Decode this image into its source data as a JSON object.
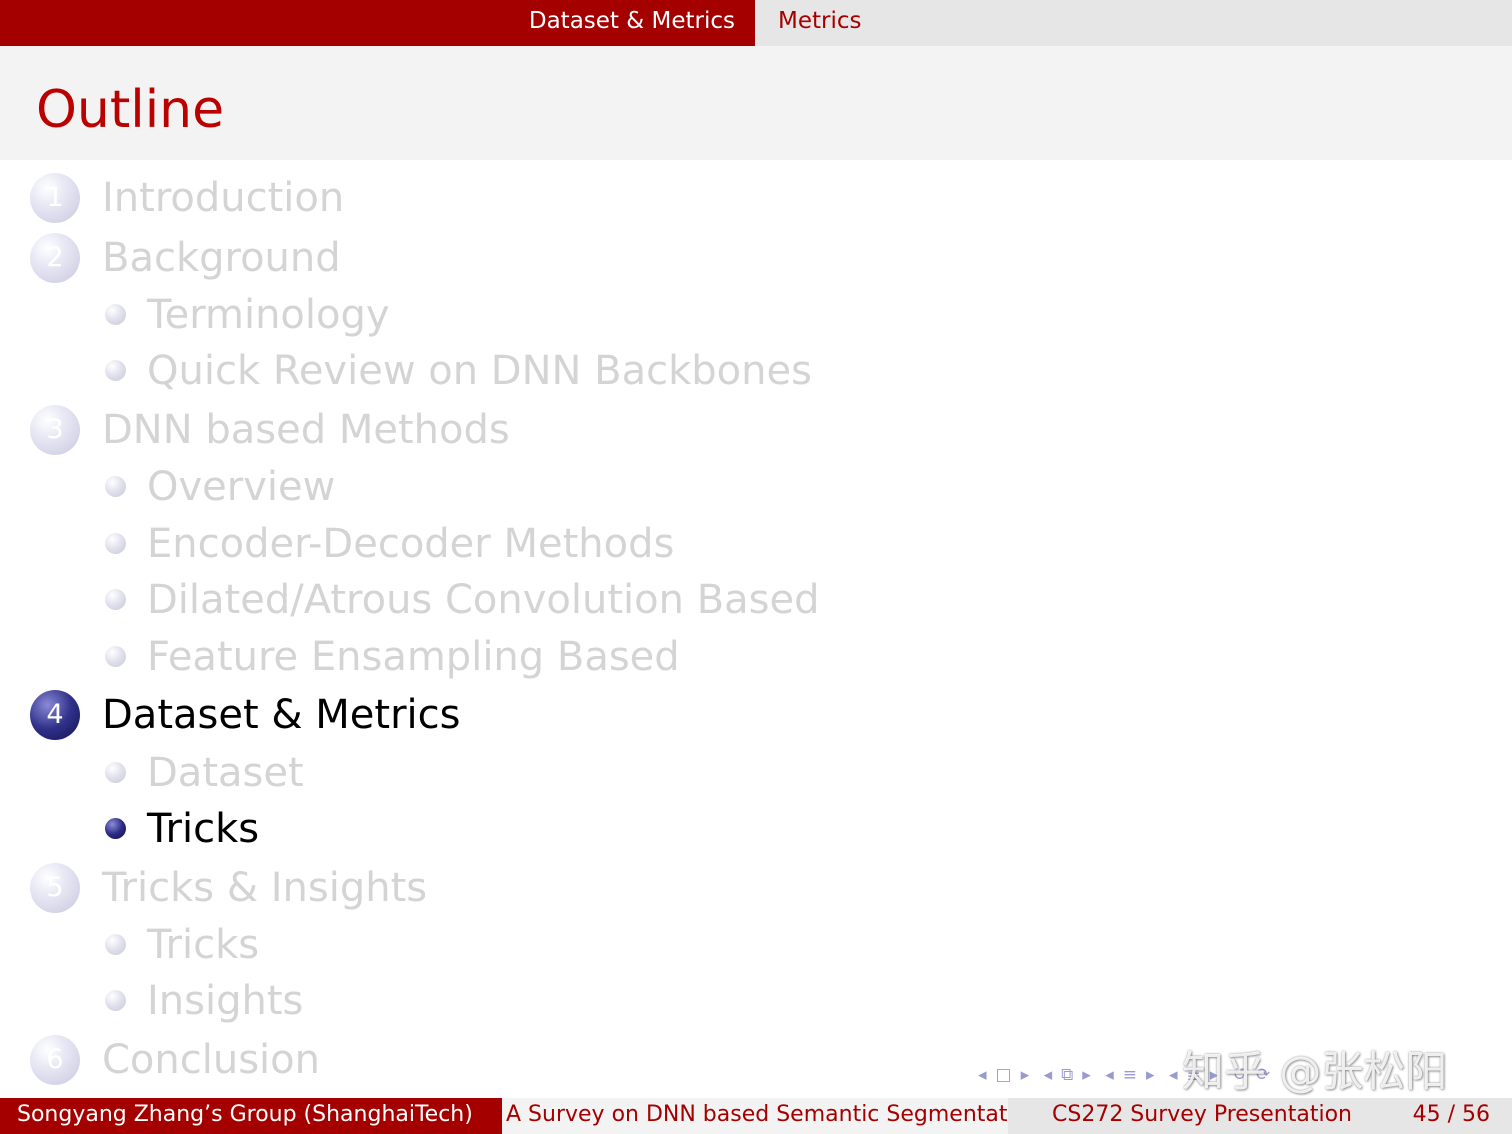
{
  "header": {
    "section": "Dataset & Metrics",
    "subsection": "Metrics"
  },
  "frame": {
    "title": "Outline"
  },
  "toc": {
    "sections": [
      {
        "number": "1",
        "label": "Introduction",
        "active": false,
        "subsections": []
      },
      {
        "number": "2",
        "label": "Background",
        "active": false,
        "subsections": [
          {
            "label": "Terminology",
            "active": false
          },
          {
            "label": "Quick Review on DNN Backbones",
            "active": false
          }
        ]
      },
      {
        "number": "3",
        "label": "DNN based Methods",
        "active": false,
        "subsections": [
          {
            "label": "Overview",
            "active": false
          },
          {
            "label": "Encoder-Decoder Methods",
            "active": false
          },
          {
            "label": "Dilated/Atrous Convolution Based",
            "active": false
          },
          {
            "label": "Feature Ensampling Based",
            "active": false
          }
        ]
      },
      {
        "number": "4",
        "label": "Dataset & Metrics",
        "active": true,
        "subsections": [
          {
            "label": "Dataset",
            "active": false
          },
          {
            "label": "Tricks",
            "active": true
          }
        ]
      },
      {
        "number": "5",
        "label": "Tricks & Insights",
        "active": false,
        "subsections": [
          {
            "label": "Tricks",
            "active": false
          },
          {
            "label": "Insights",
            "active": false
          }
        ]
      },
      {
        "number": "6",
        "label": "Conclusion",
        "active": false,
        "subsections": []
      }
    ]
  },
  "watermark": "知乎 @张松阳",
  "footer": {
    "author": "Songyang Zhang’s Group  (ShanghaiTech)",
    "title": "A Survey on DNN based Semantic Segmentat",
    "subtitle": "CS272 Survey Presentation",
    "page": "45 / 56"
  },
  "colors": {
    "accent": "#a50000",
    "title": "#bb0000",
    "active_ball": "#30308a",
    "shaded_text": "#d4d4d4"
  },
  "icons": {
    "navigation": [
      "nav-left-arrow-icon",
      "frame-icon",
      "nav-right-arrow-icon",
      "nav-left-arrow-icon",
      "subsection-icon",
      "nav-right-arrow-icon",
      "nav-left-arrow-icon",
      "section-icon",
      "nav-right-arrow-icon",
      "nav-left-arrow-icon",
      "document-icon",
      "nav-right-arrow-icon",
      "back-icon",
      "search-icon"
    ]
  }
}
